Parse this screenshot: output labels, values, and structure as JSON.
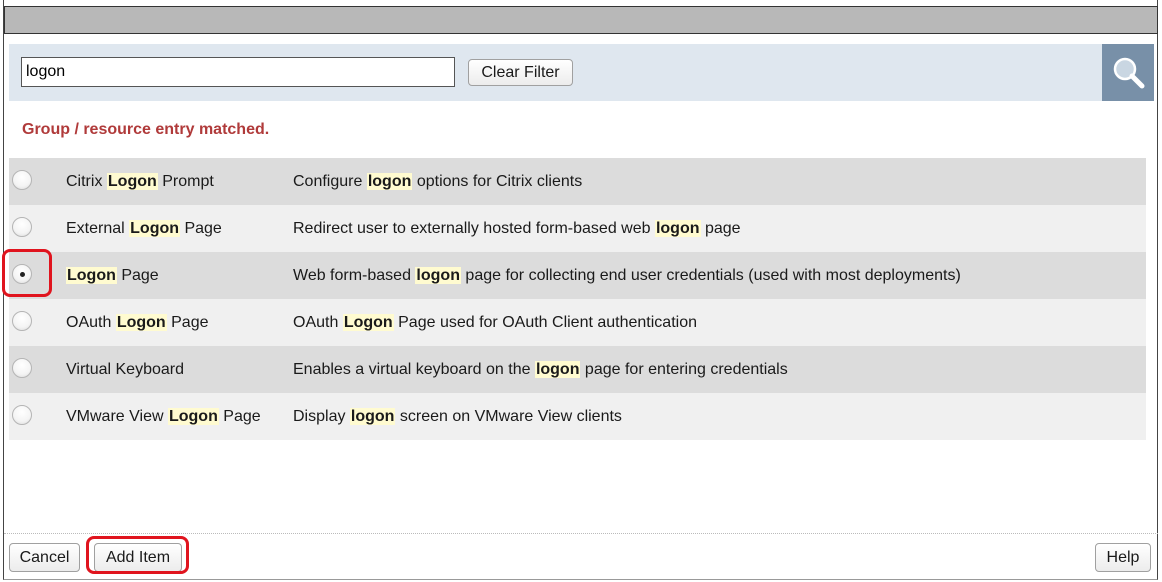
{
  "search": {
    "value": "logon",
    "clear_label": "Clear Filter"
  },
  "status_message": "Group / resource entry matched.",
  "items": [
    {
      "name": [
        "Citrix ",
        "Logon",
        " Prompt"
      ],
      "desc": [
        "Configure ",
        "logon",
        " options for Citrix clients"
      ],
      "selected": false
    },
    {
      "name": [
        "External ",
        "Logon",
        " Page"
      ],
      "desc": [
        "Redirect user to externally hosted form-based web ",
        "logon",
        " page"
      ],
      "selected": false
    },
    {
      "name": [
        "",
        "Logon",
        " Page"
      ],
      "desc": [
        "Web form-based ",
        "logon",
        " page for collecting end user credentials (used with most deployments)"
      ],
      "selected": true
    },
    {
      "name": [
        "OAuth ",
        "Logon",
        " Page"
      ],
      "desc": [
        "OAuth ",
        "Logon",
        " Page used for OAuth Client authentication"
      ],
      "selected": false
    },
    {
      "name": [
        "Virtual Keyboard",
        "",
        ""
      ],
      "desc": [
        "Enables a virtual keyboard on the ",
        "logon",
        " page for entering credentials"
      ],
      "selected": false
    },
    {
      "name": [
        "VMware View ",
        "Logon",
        " Page"
      ],
      "desc": [
        "Display ",
        "logon",
        " screen on VMware View clients"
      ],
      "selected": false
    }
  ],
  "footer": {
    "cancel_label": "Cancel",
    "add_label": "Add Item",
    "help_label": "Help"
  },
  "colors": {
    "highlight": "#fffbd0",
    "status": "#b03a3a",
    "annotation": "#e0141e",
    "search_button": "#7890a8"
  }
}
